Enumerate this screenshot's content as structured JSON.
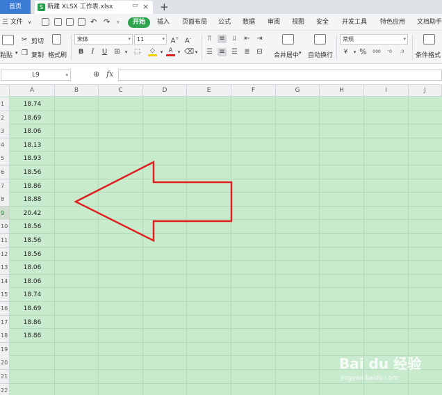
{
  "titlebar": {
    "home_tab": "首页",
    "file_tab": "新建 XLSX 工作表.xlsx",
    "file_icon": "S",
    "window_icon": "window-icon",
    "close_glyph": "×",
    "add_glyph": "+"
  },
  "menubar": {
    "file_menu": "三 文件",
    "file_menu_arrow": "∨",
    "active_tab": "开始",
    "tabs": [
      "插入",
      "页面布局",
      "公式",
      "数据",
      "审阅",
      "视图",
      "安全",
      "开发工具",
      "特色应用",
      "文档助手"
    ]
  },
  "ribbon": {
    "paste": "粘贴",
    "cut": "剪切",
    "copy": "复制",
    "format_painter": "格式刷",
    "font_name": "宋体",
    "font_size": "11",
    "bold": "B",
    "italic": "I",
    "underline": "U",
    "merge_center": "合并居中",
    "wrap_text": "自动换行",
    "number_format": "常规",
    "currency": "¥",
    "percent": "%",
    "thousands": "000",
    "conditional_format": "条件格式",
    "font_color": "#e02020",
    "fill_color": "#f5d000"
  },
  "formulabar": {
    "name_box": "L9",
    "fx": "fx",
    "formula_value": ""
  },
  "sheet": {
    "columns": [
      "A",
      "B",
      "C",
      "D",
      "E",
      "F",
      "G",
      "H",
      "I",
      "J"
    ],
    "rows": [
      "1",
      "2",
      "3",
      "4",
      "5",
      "6",
      "7",
      "8",
      "9",
      "10",
      "11",
      "12",
      "13",
      "14",
      "15",
      "16",
      "17",
      "18",
      "19",
      "20",
      "21",
      "22"
    ],
    "active_row": "9",
    "column_a_values": [
      "18.74",
      "18.69",
      "18.06",
      "18.13",
      "18.93",
      "18.56",
      "18.86",
      "18.88",
      "20.42",
      "18.56",
      "18.56",
      "18.56",
      "18.06",
      "18.06",
      "18.74",
      "18.69",
      "18.86",
      "18.86"
    ],
    "grid_color": "#c8eacd",
    "annotation_color": "#e02020"
  },
  "watermark": {
    "brand": "Bai du 经验",
    "url": "jingyan.baidu.com"
  }
}
